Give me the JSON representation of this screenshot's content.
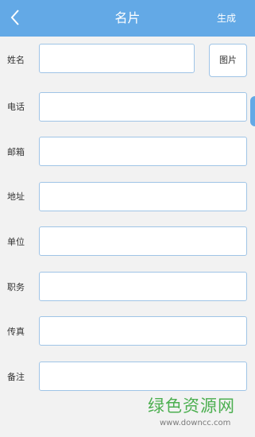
{
  "header": {
    "title": "名片",
    "action_label": "生成",
    "back_icon": "chevron-left-icon",
    "background_color": "#63a9e6"
  },
  "form": {
    "fields": [
      {
        "label": "姓名",
        "value": "",
        "placeholder": ""
      },
      {
        "label": "电话",
        "value": "",
        "placeholder": ""
      },
      {
        "label": "邮箱",
        "value": "",
        "placeholder": ""
      },
      {
        "label": "地址",
        "value": "",
        "placeholder": ""
      },
      {
        "label": "单位",
        "value": "",
        "placeholder": ""
      },
      {
        "label": "职务",
        "value": "",
        "placeholder": ""
      },
      {
        "label": "传真",
        "value": "",
        "placeholder": ""
      },
      {
        "label": "备注",
        "value": "",
        "placeholder": ""
      }
    ],
    "photo_button_label": "图片",
    "field_border_color": "#9fc4e6"
  },
  "watermark": {
    "text": "绿色资源网",
    "url": "www.downcc.com"
  }
}
